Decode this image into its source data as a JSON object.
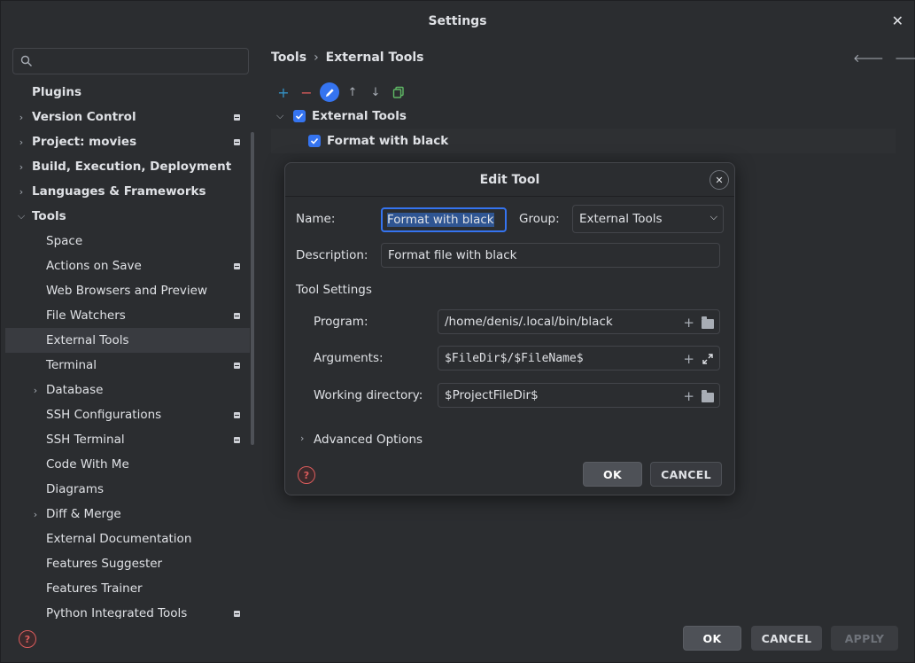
{
  "window": {
    "title": "Settings"
  },
  "search": {
    "placeholder": ""
  },
  "sidebar": {
    "items": [
      {
        "label": "Plugins",
        "level": 0,
        "expand": "none",
        "managed": false,
        "selected": false
      },
      {
        "label": "Version Control",
        "level": 0,
        "expand": "collapsed",
        "managed": true,
        "selected": false
      },
      {
        "label": "Project: movies",
        "level": 0,
        "expand": "collapsed",
        "managed": true,
        "selected": false
      },
      {
        "label": "Build, Execution, Deployment",
        "level": 0,
        "expand": "collapsed",
        "managed": false,
        "selected": false
      },
      {
        "label": "Languages & Frameworks",
        "level": 0,
        "expand": "collapsed",
        "managed": false,
        "selected": false
      },
      {
        "label": "Tools",
        "level": 0,
        "expand": "expanded",
        "managed": false,
        "selected": false
      },
      {
        "label": "Space",
        "level": 1,
        "expand": "none",
        "managed": false,
        "selected": false
      },
      {
        "label": "Actions on Save",
        "level": 1,
        "expand": "none",
        "managed": true,
        "selected": false
      },
      {
        "label": "Web Browsers and Preview",
        "level": 1,
        "expand": "none",
        "managed": false,
        "selected": false
      },
      {
        "label": "File Watchers",
        "level": 1,
        "expand": "none",
        "managed": true,
        "selected": false
      },
      {
        "label": "External Tools",
        "level": 1,
        "expand": "none",
        "managed": false,
        "selected": true
      },
      {
        "label": "Terminal",
        "level": 1,
        "expand": "none",
        "managed": true,
        "selected": false
      },
      {
        "label": "Database",
        "level": 1,
        "expand": "collapsed",
        "managed": false,
        "selected": false
      },
      {
        "label": "SSH Configurations",
        "level": 1,
        "expand": "none",
        "managed": true,
        "selected": false
      },
      {
        "label": "SSH Terminal",
        "level": 1,
        "expand": "none",
        "managed": true,
        "selected": false
      },
      {
        "label": "Code With Me",
        "level": 1,
        "expand": "none",
        "managed": false,
        "selected": false
      },
      {
        "label": "Diagrams",
        "level": 1,
        "expand": "none",
        "managed": false,
        "selected": false
      },
      {
        "label": "Diff & Merge",
        "level": 1,
        "expand": "collapsed",
        "managed": false,
        "selected": false
      },
      {
        "label": "External Documentation",
        "level": 1,
        "expand": "none",
        "managed": false,
        "selected": false
      },
      {
        "label": "Features Suggester",
        "level": 1,
        "expand": "none",
        "managed": false,
        "selected": false
      },
      {
        "label": "Features Trainer",
        "level": 1,
        "expand": "none",
        "managed": false,
        "selected": false
      },
      {
        "label": "Python Integrated Tools",
        "level": 1,
        "expand": "none",
        "managed": true,
        "selected": false
      }
    ]
  },
  "breadcrumb": {
    "parent": "Tools",
    "separator": "›",
    "current": "External Tools"
  },
  "toolbar": {
    "add": "+",
    "remove": "−",
    "move_up": "↑",
    "move_down": "↓"
  },
  "external_tools": {
    "group_label": "External Tools",
    "group_checked": true,
    "tool_label": "Format with black",
    "tool_checked": true
  },
  "dialog": {
    "title": "Edit Tool",
    "name_label": "Name:",
    "name_value": "Format with black",
    "group_label": "Group:",
    "group_value": "External Tools",
    "description_label": "Description:",
    "description_value": "Format file with black",
    "tool_settings_label": "Tool Settings",
    "program_label": "Program:",
    "program_value": "/home/denis/.local/bin/black",
    "arguments_label": "Arguments:",
    "arguments_value": "$FileDir$/$FileName$",
    "workdir_label": "Working directory:",
    "workdir_value": "$ProjectFileDir$",
    "advanced_label": "Advanced Options",
    "ok_label": "OK",
    "cancel_label": "CANCEL"
  },
  "footer": {
    "ok_label": "OK",
    "cancel_label": "CANCEL",
    "apply_label": "APPLY"
  },
  "colors": {
    "accent": "#3574f0",
    "background": "#2b2d30",
    "selection": "#393b40",
    "help": "#db5c5c"
  }
}
